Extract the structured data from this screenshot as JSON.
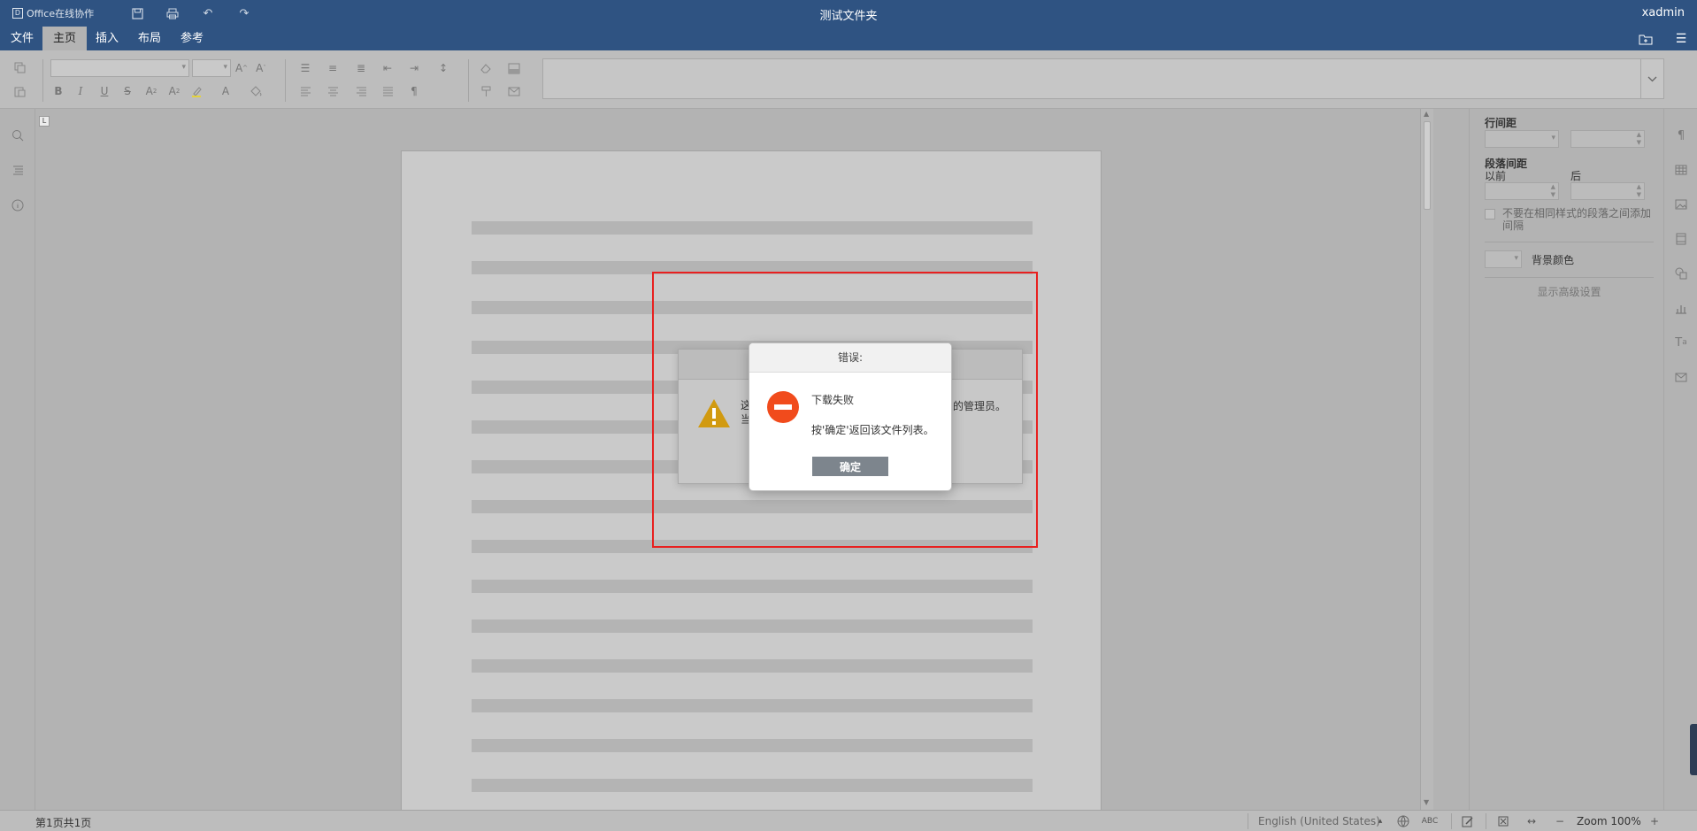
{
  "window": {
    "brand": "Office在线协作",
    "doc_title": "测试文件夹",
    "user": "xadmin"
  },
  "ribbon": {
    "tabs": [
      {
        "label": "文件"
      },
      {
        "label": "主页"
      },
      {
        "label": "插入"
      },
      {
        "label": "布局"
      },
      {
        "label": "参考"
      }
    ]
  },
  "right_panel": {
    "line_spacing": "行间距",
    "paragraph_spacing": "段落间距",
    "before": "以前",
    "after": "后",
    "no_space_checkbox": "不要在相同样式的段落之间添加间隔",
    "background_color": "背景颜色",
    "advanced_settings": "显示高级设置"
  },
  "status": {
    "page_info": "第1页共1页",
    "language": "English (United States)",
    "zoom": "Zoom 100%"
  },
  "warning_dialog": {
    "text_a": "这",
    "text_b": "当",
    "text_c": "的管理员。"
  },
  "error_dialog": {
    "title": "错误:",
    "message": "下载失败",
    "hint": "按'确定'返回该文件列表。",
    "ok_label": "确定"
  },
  "colors": {
    "title_bar": "#2f5382",
    "error_icon": "#f14b1c",
    "warning_icon": "#d19a10",
    "highlight": "#e8201f"
  }
}
